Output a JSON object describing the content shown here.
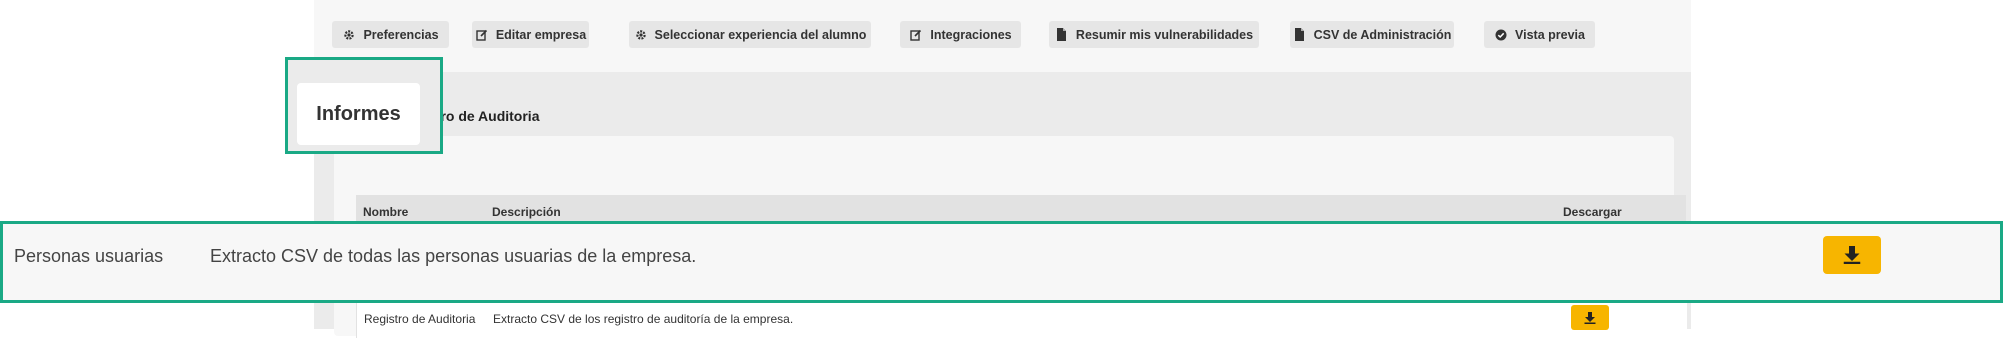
{
  "toolbar": {
    "buttons": [
      {
        "label": "Preferencias",
        "icon": "gear-icon"
      },
      {
        "label": "Editar empresa",
        "icon": "edit-icon"
      },
      {
        "label": "Seleccionar experiencia del alumno",
        "icon": "gear-icon"
      },
      {
        "label": "Integraciones",
        "icon": "edit-icon"
      },
      {
        "label": "Resumir mis vulnerabilidades",
        "icon": "file-icon"
      },
      {
        "label": "CSV de Administración",
        "icon": "file-icon"
      },
      {
        "label": "Vista previa",
        "icon": "check-circle-icon"
      }
    ]
  },
  "tabs": [
    {
      "label": "Informes",
      "active": true
    },
    {
      "label": "stro de Auditoria",
      "active": false
    }
  ],
  "table": {
    "headers": [
      "Nombre",
      "Descripción",
      "Descargar"
    ],
    "rows": [
      {
        "name": "Personas usuarias",
        "description": "Extracto CSV de todas las personas usuarias de la empresa.",
        "download_icon": "download-icon"
      },
      {
        "name": "Registro de Auditoria",
        "description": "Extracto CSV de los registro de auditoría de la empresa.",
        "download_icon": "download-icon"
      }
    ]
  },
  "colors": {
    "accent_highlight": "#1aa985",
    "download_button": "#f7b500",
    "toolbar_bg": "#f7f7f7",
    "panel_bg": "#ebebeb"
  }
}
